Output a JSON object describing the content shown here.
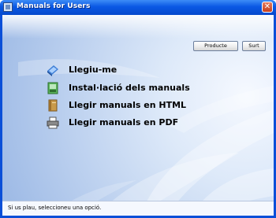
{
  "window": {
    "title": "Manuals for Users",
    "close_glyph": "✕"
  },
  "toolbar": {
    "products_label": "Producte",
    "exit_label": "Surt"
  },
  "menu": [
    {
      "label": "Llegiu-me",
      "icon": "readme-icon"
    },
    {
      "label": "Instal·lació dels manuals",
      "icon": "install-icon"
    },
    {
      "label": "Llegir manuals en HTML",
      "icon": "book-icon"
    },
    {
      "label": "Llegir manuals en PDF",
      "icon": "printer-icon"
    }
  ],
  "status": {
    "text": "Si us plau, seleccioneu una opció."
  },
  "colors": {
    "titlebar": "#0a58e4",
    "background_light": "#f6f9ff",
    "background_dark": "#9fbbe6"
  }
}
